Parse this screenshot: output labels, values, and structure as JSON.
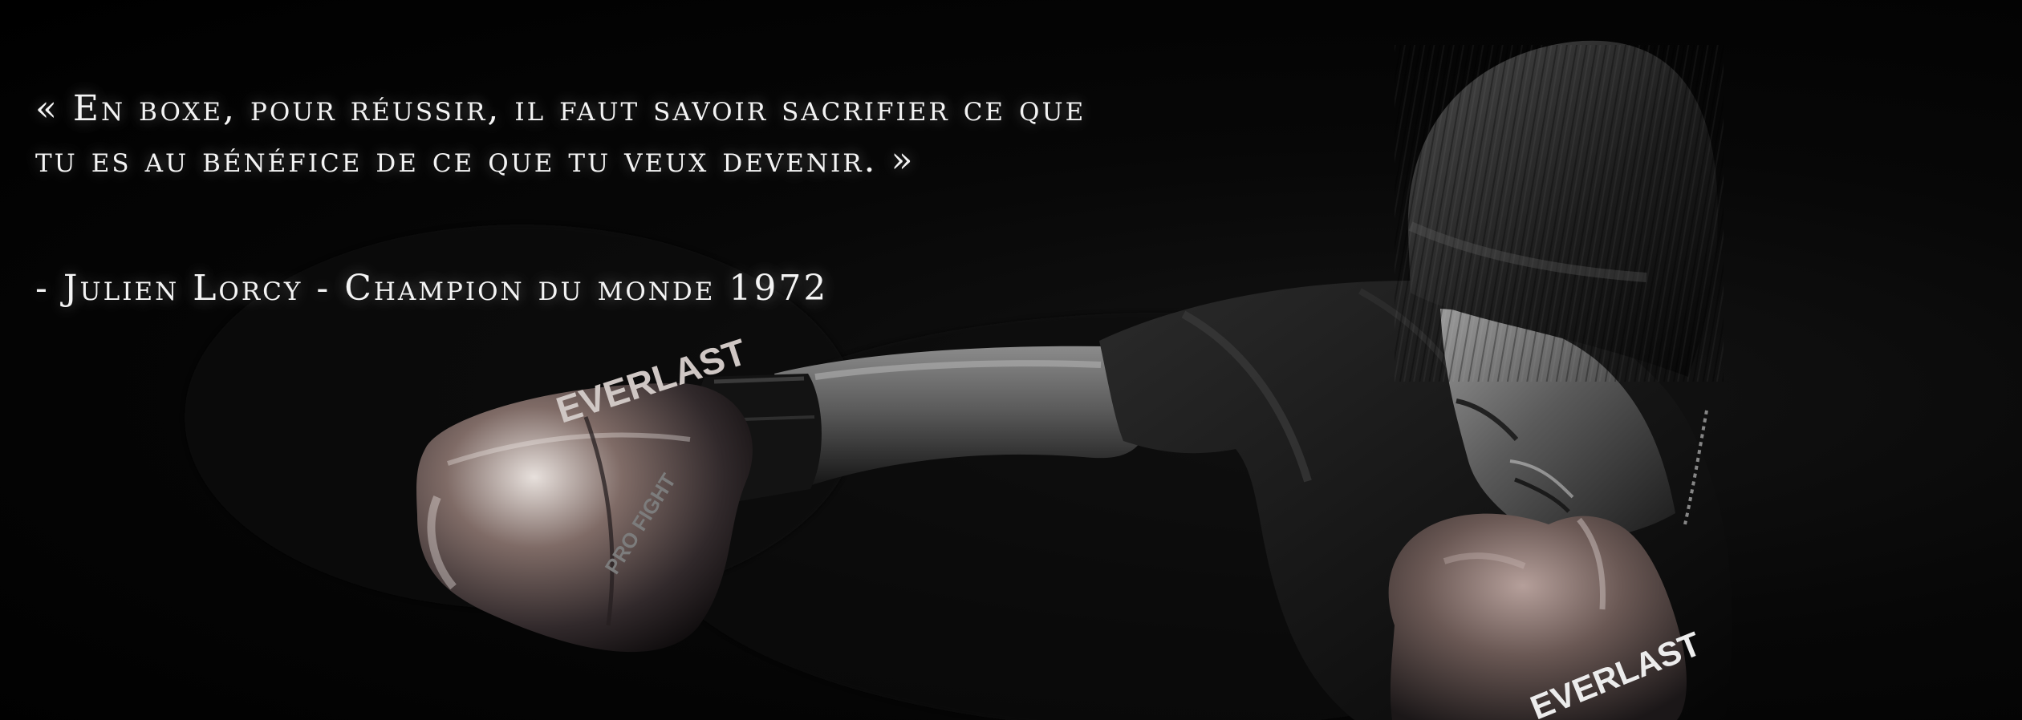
{
  "quote": {
    "line1": "« En boxe, pour réussir, il faut savoir sacrifier ce que",
    "line2": "tu es au bénéfice de ce que tu veux devenir. »"
  },
  "attribution": "- Julien Lorcy - Champion du monde 1972",
  "glove_brands": {
    "front_glove": "PRO FIGHT",
    "rear_glove": "EVERLAST"
  }
}
